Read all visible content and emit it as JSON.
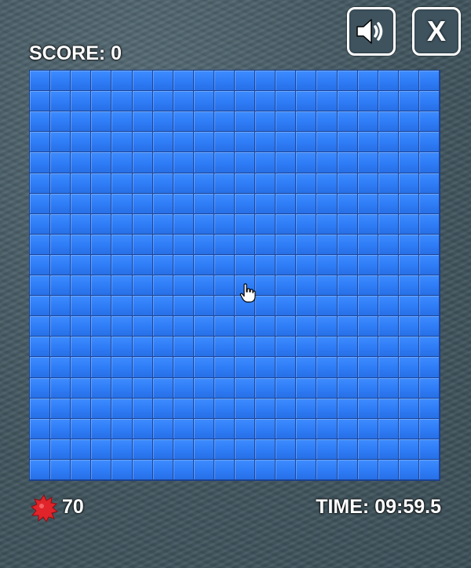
{
  "hud": {
    "score_text": "SCORE: 0",
    "mines_remaining": "70",
    "time_text": "TIME: 09:59.5"
  },
  "buttons": {
    "sound_icon": "speaker-icon",
    "close_label": "X"
  },
  "board": {
    "rows": 20,
    "cols": 20,
    "cell_state": "covered"
  },
  "colors": {
    "tile": "#2e7cf6",
    "tile_border": "#1d4598",
    "mine": "#e0242a"
  }
}
